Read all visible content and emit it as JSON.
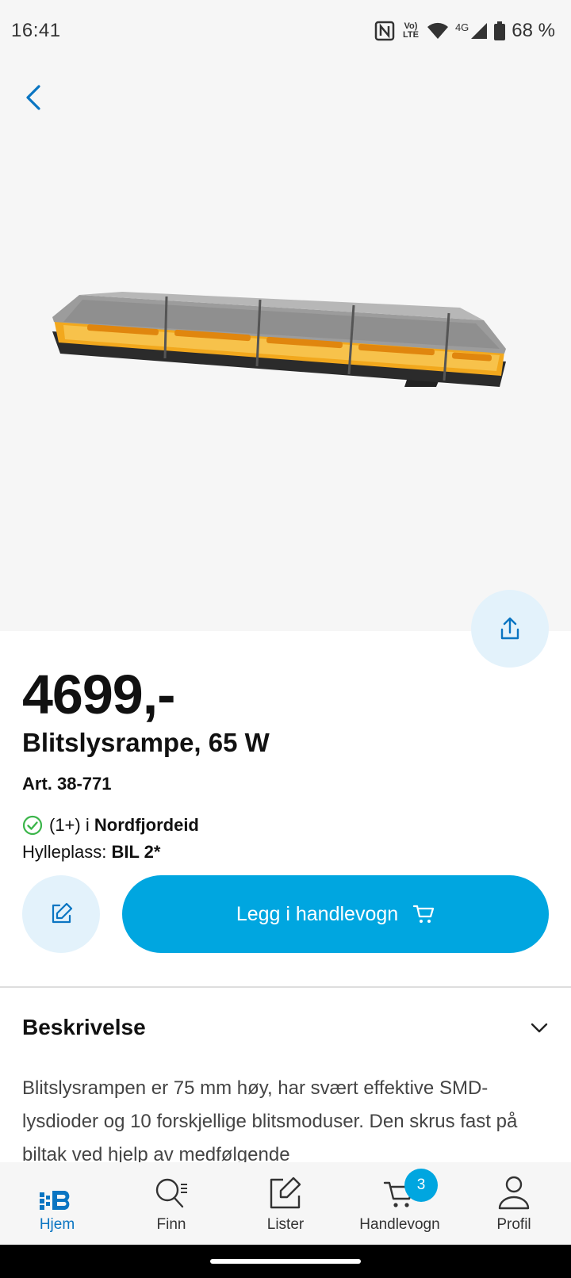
{
  "status": {
    "time": "16:41",
    "battery": "68 %",
    "network": "4G",
    "volte": "Vo) LTE"
  },
  "product": {
    "price": "4699,-",
    "title": "Blitslysrampe, 65 W",
    "article": "Art. 38-771",
    "stock_count": "(1+) i",
    "stock_store": "Nordfjordeid",
    "shelf_label": "Hylleplass:",
    "shelf_value": "BIL 2*"
  },
  "actions": {
    "add_to_cart": "Legg i handlevogn"
  },
  "description": {
    "header": "Beskrivelse",
    "text": "Blitslysrampen er 75 mm høy, har svært effektive SMD-lysdioder og 10 forskjellige blitsmoduser. Den skrus fast på biltak ved hjelp av medfølgende"
  },
  "nav": {
    "items": [
      {
        "label": "Hjem",
        "icon": "home-logo-icon",
        "active": true
      },
      {
        "label": "Finn",
        "icon": "search-list-icon"
      },
      {
        "label": "Lister",
        "icon": "edit-list-icon"
      },
      {
        "label": "Handlevogn",
        "icon": "cart-icon",
        "badge": "3"
      },
      {
        "label": "Profil",
        "icon": "profile-icon"
      }
    ]
  },
  "colors": {
    "accent": "#00a6e0",
    "active_nav": "#0a75c2",
    "light_accent": "#e3f2fb",
    "check": "#3bb54a"
  }
}
